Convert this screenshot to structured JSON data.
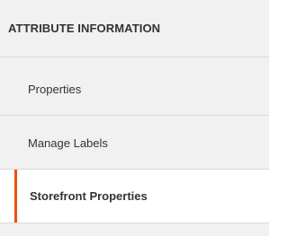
{
  "panel": {
    "title": "ATTRIBUTE INFORMATION",
    "items": [
      {
        "label": "Properties",
        "active": false
      },
      {
        "label": "Manage Labels",
        "active": false
      },
      {
        "label": "Storefront Properties",
        "active": true
      }
    ]
  },
  "colors": {
    "accent": "#eb5202",
    "panel_background": "#f1f1f1",
    "active_background": "#ffffff",
    "text": "#333333"
  }
}
